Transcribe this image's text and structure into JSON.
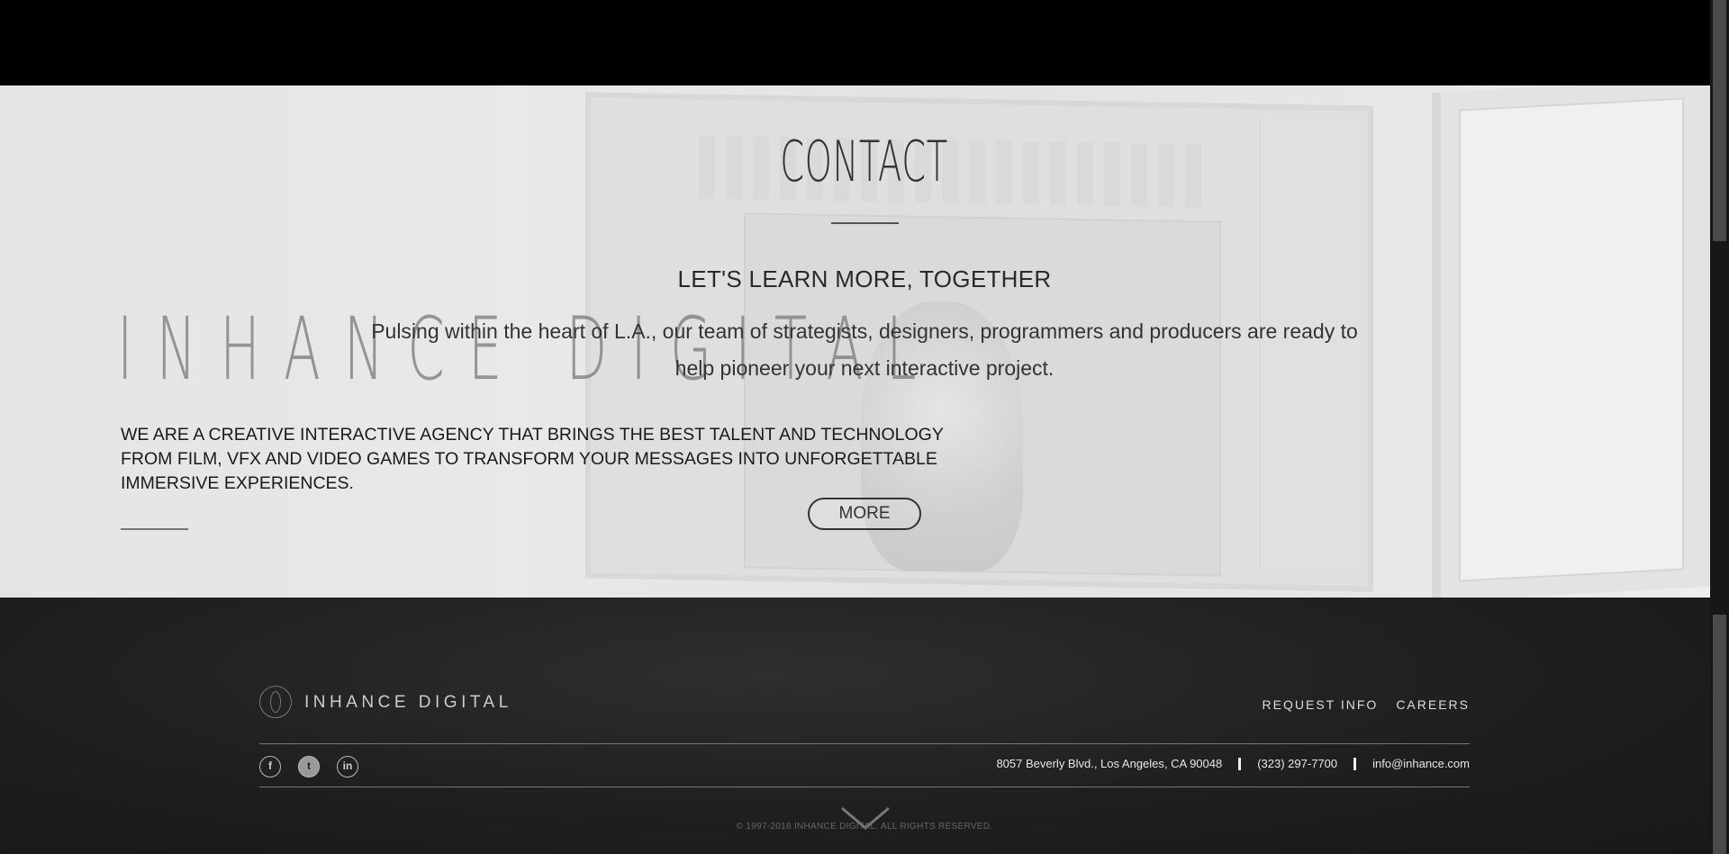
{
  "hero": {
    "brand_watermark": "INHANCE DIGITAL",
    "tagline": "WE ARE A CREATIVE INTERACTIVE AGENCY THAT BRINGS THE BEST TALENT AND TECHNOLOGY FROM FILM, VFX AND VIDEO GAMES TO TRANSFORM YOUR MESSAGES INTO UNFORGETTABLE IMMERSIVE EXPERIENCES."
  },
  "contact": {
    "title": "CONTACT",
    "heading": "LET'S LEARN MORE, TOGETHER",
    "body": "Pulsing within the heart of L.A., our team of strategists, designers, programmers and producers are ready to help pioneer your next interactive project.",
    "more_label": "MORE"
  },
  "footer": {
    "brand": "INHANCE DIGITAL",
    "logo_icon": "inhance-logo-icon",
    "nav": [
      {
        "label": "REQUEST INFO"
      },
      {
        "label": "CAREERS"
      }
    ],
    "social": [
      {
        "icon": "facebook-icon",
        "glyph": "f"
      },
      {
        "icon": "twitter-icon",
        "glyph": "t"
      },
      {
        "icon": "linkedin-icon",
        "glyph": "in"
      }
    ],
    "address": "8057 Beverly Blvd., Los Angeles, CA 90048",
    "phone": "(323) 297-7700",
    "email": "info@inhance.com",
    "copyright": "© 1997-2018 INHANCE DIGITAL. ALL RIGHTS RESERVED.",
    "scroll_icon": "chevron-down-icon"
  },
  "colors": {
    "background": "#000000",
    "footer": "#1e1e1e",
    "text_dark": "#333333",
    "text_light": "#e6e6e6"
  }
}
